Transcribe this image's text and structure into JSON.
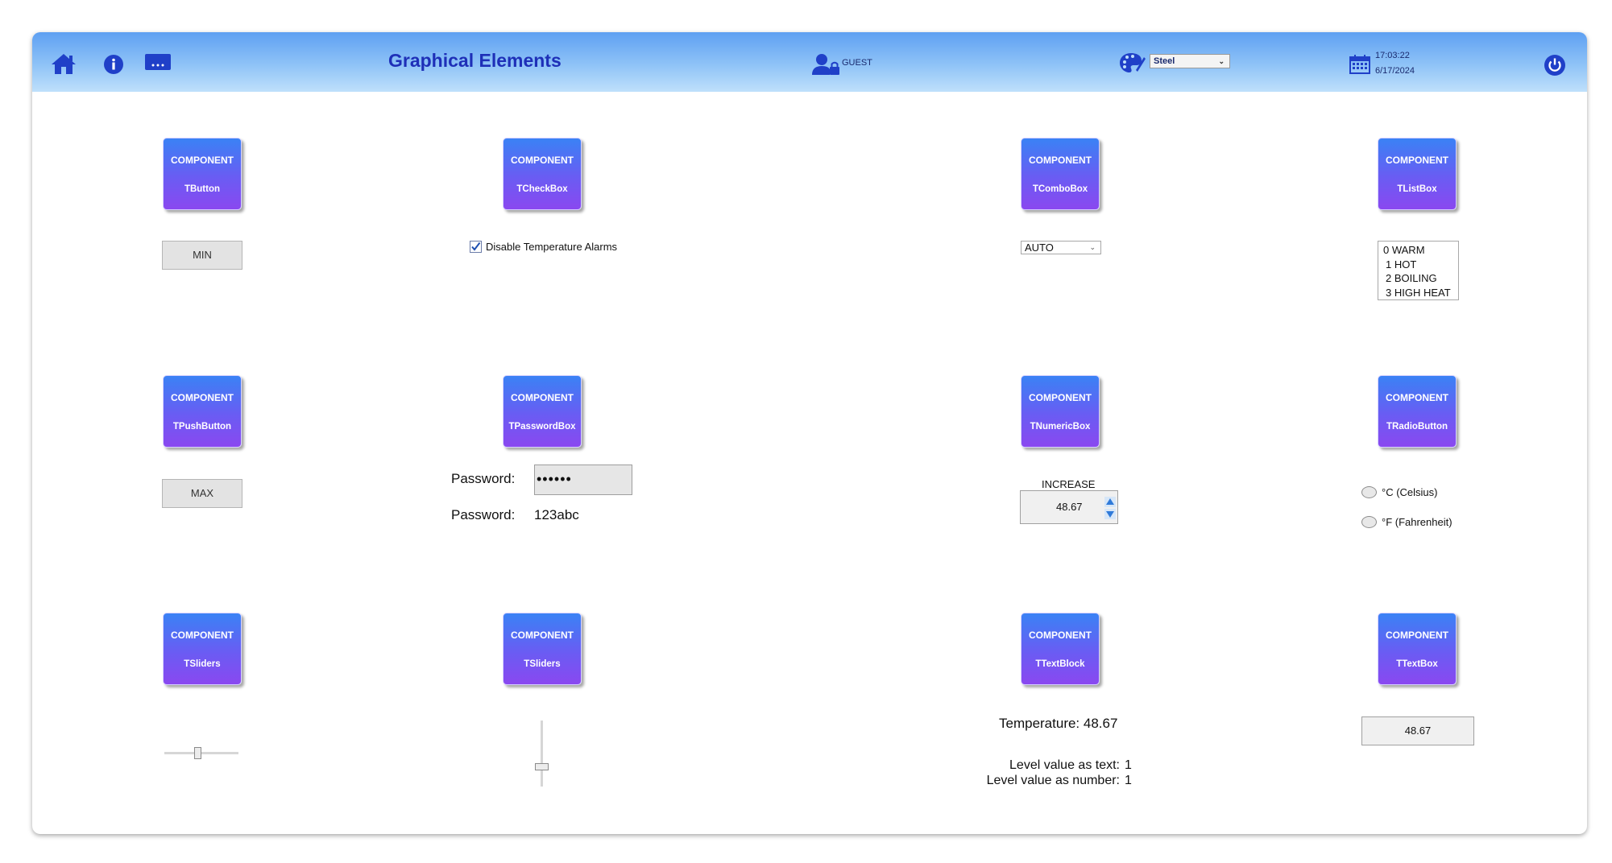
{
  "header": {
    "title": "Graphical Elements",
    "user": "GUEST",
    "theme": "Steel",
    "time": "17:03:22",
    "date": "6/17/2024",
    "icons": [
      "home-icon",
      "info-icon",
      "more-icon",
      "user-lock-icon",
      "palette-icon",
      "calendar-icon",
      "power-icon"
    ],
    "accent_color": "#1e2fb8"
  },
  "components": {
    "caption": "COMPONENT",
    "button": "TButton",
    "checkbox": "TCheckBox",
    "combobox": "TComboBox",
    "listbox": "TListBox",
    "pushbutton": "TPushButton",
    "passwordbox": "TPasswordBox",
    "numericbox": "TNumericBox",
    "radiobutton": "TRadioButton",
    "slider_h": "TSliders",
    "slider_v": "TSliders",
    "textblock": "TTextBlock",
    "textbox": "TTextBox"
  },
  "controls": {
    "min_button": "MIN",
    "max_button": "MAX",
    "checkbox_label": "Disable Temperature Alarms",
    "checkbox_checked": true,
    "combo_value": "AUTO",
    "list_items": [
      "0 WARM",
      "1 HOT",
      "2 BOILING",
      "3 HIGH HEAT"
    ],
    "password_label": "Password:",
    "password_masked": "••••••",
    "password_label2": "Password:",
    "password_plain": "123abc",
    "numeric_label": "INCREASE",
    "numeric_value": "48.67",
    "radio_celsius": "°C (Celsius)",
    "radio_fahrenheit": "°F (Fahrenheit)",
    "slider_h_level": 0.45,
    "slider_v_level": 0.3,
    "temperature_text": "Temperature: 48.67",
    "level_text_label": "Level value as text:",
    "level_text_value": "1",
    "level_number_label": "Level value as number:",
    "level_number_value": "1",
    "textbox_value": "48.67"
  }
}
